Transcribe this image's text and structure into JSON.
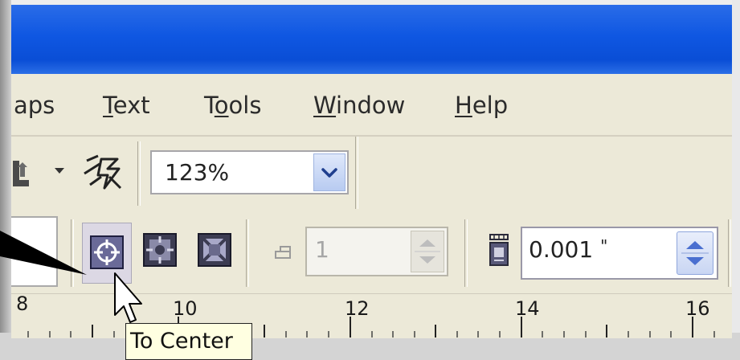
{
  "menu": {
    "items": [
      {
        "label": "aps",
        "underline_char": ""
      },
      {
        "label": "Text",
        "underline_char": "T"
      },
      {
        "label": "Tools",
        "underline_char": "o"
      },
      {
        "label": "Window",
        "underline_char": "W"
      },
      {
        "label": "Help",
        "underline_char": "H"
      }
    ]
  },
  "toolbar": {
    "zoom_value": "123%",
    "zoom_dropdown_icon": "chevron-down-icon"
  },
  "property_bar": {
    "align_buttons": [
      {
        "name": "to-center-button",
        "icon": "center-target-icon",
        "pressed": true
      },
      {
        "name": "align-to-center-inner-button",
        "icon": "center-frame-icon",
        "pressed": false
      },
      {
        "name": "align-to-center-outer-button",
        "icon": "outer-frame-icon",
        "pressed": false
      }
    ],
    "step_count_value": "1",
    "offset_value": "0.001",
    "offset_unit": "\""
  },
  "ruler": {
    "labels": [
      "8",
      "10",
      "12",
      "14",
      "16"
    ]
  },
  "tooltip": {
    "text": "To Center"
  },
  "colors": {
    "titlebar": "#0f57e2",
    "menu_background": "#ece9d8",
    "tooltip_background": "#ffffe1",
    "spin_arrow": "#4a6fd0"
  }
}
